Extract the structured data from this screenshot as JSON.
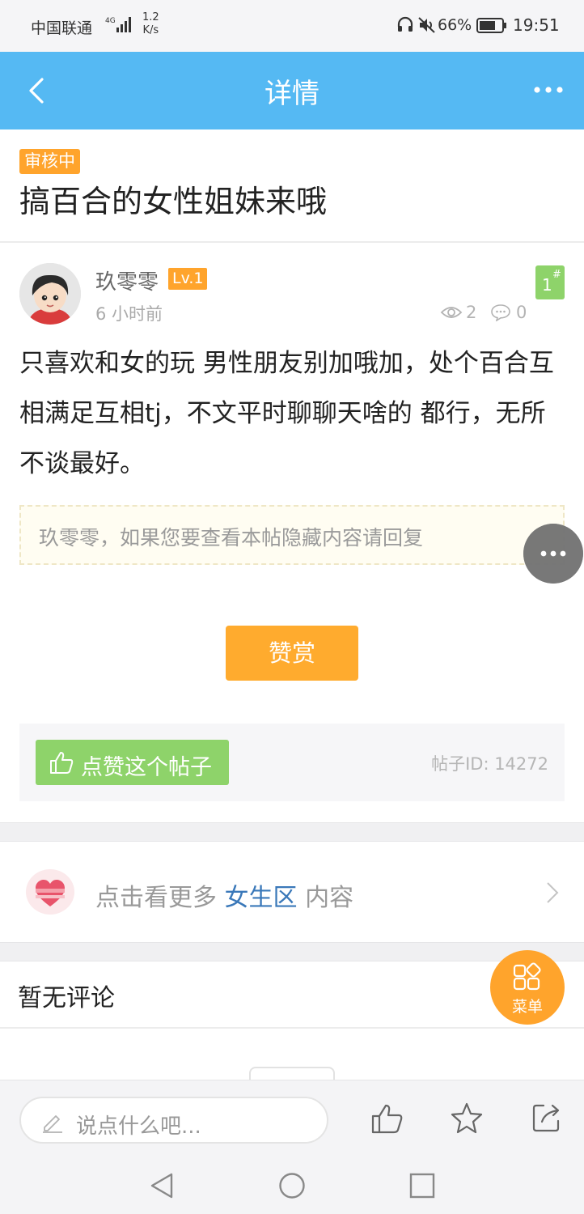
{
  "status_bar": {
    "carrier": "中国联通",
    "network": "4G",
    "speed_value": "1.2",
    "speed_unit": "K/s",
    "battery": "66%",
    "time": "19:51"
  },
  "header": {
    "title": "详情",
    "back_icon": "chevron-left-icon",
    "more_icon": "more-dots-icon",
    "background": "#55b9f3"
  },
  "post": {
    "status": "审核中",
    "title": "搞百合的女性姐妹来哦",
    "author": {
      "name": "玖零零",
      "level": "Lv.1",
      "time": "6 小时前"
    },
    "floor": "1",
    "floor_mark": "#",
    "views": "2",
    "comments": "0",
    "body": "只喜欢和女的玩 男性朋友别加哦加，处个百合互相满足互相tj，不文平时聊聊天啥的 都行，无所不谈最好。",
    "hidden_notice": "玖零零，如果您要查看本帖隐藏内容请回复",
    "reward_label": "赞赏",
    "like_label": "点赞这个帖子",
    "post_id": "帖子ID: 14272"
  },
  "section_link": {
    "prefix": "点击看更多",
    "section": "女生区",
    "suffix": "内容"
  },
  "comments_section": {
    "empty_text": "暂无评论"
  },
  "menu_fab": {
    "label": "菜单"
  },
  "bottom_bar": {
    "placeholder": "说点什么吧..."
  },
  "colors": {
    "accent_orange": "#ffa42c",
    "like_green": "#8ed36a",
    "link_blue": "#3a78b9"
  }
}
